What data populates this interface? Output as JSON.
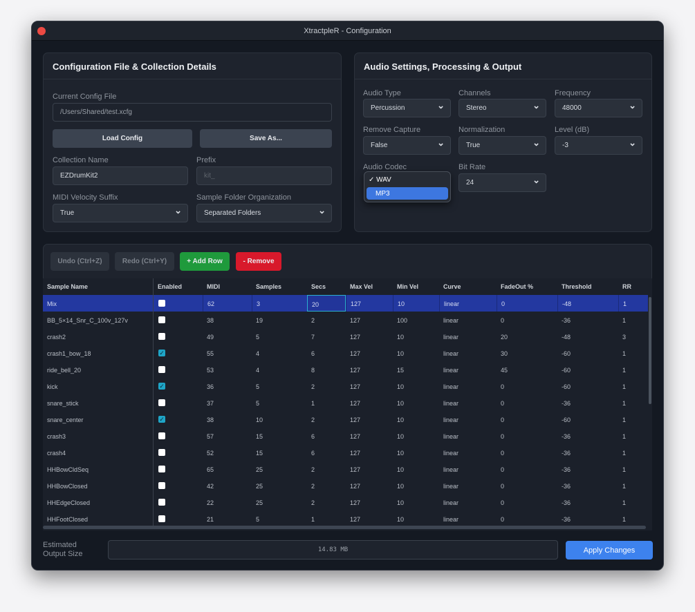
{
  "window": {
    "title": "XtractpleR - Configuration"
  },
  "config": {
    "title": "Configuration File & Collection Details",
    "current_label": "Current Config File",
    "current_value": "/Users/Shared/test.xcfg",
    "load": "Load Config",
    "save": "Save As...",
    "collection_label": "Collection Name",
    "collection_value": "EZDrumKit2",
    "prefix_label": "Prefix",
    "prefix_placeholder": "kit_",
    "midi_label": "MIDI Velocity Suffix",
    "midi_value": "True",
    "folder_label": "Sample Folder Organization",
    "folder_value": "Separated Folders"
  },
  "audio": {
    "title": "Audio Settings, Processing & Output",
    "type_label": "Audio Type",
    "type_value": "Percussion",
    "channels_label": "Channels",
    "channels_value": "Stereo",
    "freq_label": "Frequency",
    "freq_value": "48000",
    "capture_label": "Remove Capture",
    "capture_value": "False",
    "norm_label": "Normalization",
    "norm_value": "True",
    "level_label": "Level (dB)",
    "level_value": "-3",
    "codec_label": "Audio Codec",
    "codec_options": [
      "✓ WAV",
      "MP3"
    ],
    "bitrate_label": "Bit Rate",
    "bitrate_value": "24"
  },
  "toolbar": {
    "undo": "Undo (Ctrl+Z)",
    "redo": "Redo (Ctrl+Y)",
    "add": "+ Add Row",
    "remove": "- Remove"
  },
  "colors": {
    "add": "#1f9a3c",
    "remove": "#d8192b",
    "apply": "#3d82ee",
    "selected_row": "#2338a0"
  },
  "table": {
    "columns": [
      "Sample Name",
      "Enabled",
      "MIDI",
      "Samples",
      "Secs",
      "Max Vel",
      "Min Vel",
      "Curve",
      "FadeOut %",
      "Threshold",
      "RR"
    ],
    "rows": [
      [
        "Mix",
        false,
        "62",
        "3",
        "20",
        "127",
        "10",
        "linear",
        "0",
        "-48",
        "1"
      ],
      [
        "BB_5×14_Snr_C_100v_127v",
        false,
        "38",
        "19",
        "2",
        "127",
        "100",
        "linear",
        "0",
        "-36",
        "1"
      ],
      [
        "crash2",
        false,
        "49",
        "5",
        "7",
        "127",
        "10",
        "linear",
        "20",
        "-48",
        "3"
      ],
      [
        "crash1_bow_18",
        true,
        "55",
        "4",
        "6",
        "127",
        "10",
        "linear",
        "30",
        "-60",
        "1"
      ],
      [
        "ride_bell_20",
        false,
        "53",
        "4",
        "8",
        "127",
        "15",
        "linear",
        "45",
        "-60",
        "1"
      ],
      [
        "kick",
        true,
        "36",
        "5",
        "2",
        "127",
        "10",
        "linear",
        "0",
        "-60",
        "1"
      ],
      [
        "snare_stick",
        false,
        "37",
        "5",
        "1",
        "127",
        "10",
        "linear",
        "0",
        "-36",
        "1"
      ],
      [
        "snare_center",
        true,
        "38",
        "10",
        "2",
        "127",
        "10",
        "linear",
        "0",
        "-60",
        "1"
      ],
      [
        "crash3",
        false,
        "57",
        "15",
        "6",
        "127",
        "10",
        "linear",
        "0",
        "-36",
        "1"
      ],
      [
        "crash4",
        false,
        "52",
        "15",
        "6",
        "127",
        "10",
        "linear",
        "0",
        "-36",
        "1"
      ],
      [
        "HHBowCldSeq",
        false,
        "65",
        "25",
        "2",
        "127",
        "10",
        "linear",
        "0",
        "-36",
        "1"
      ],
      [
        "HHBowClosed",
        false,
        "42",
        "25",
        "2",
        "127",
        "10",
        "linear",
        "0",
        "-36",
        "1"
      ],
      [
        "HHEdgeClosed",
        false,
        "22",
        "25",
        "2",
        "127",
        "10",
        "linear",
        "0",
        "-36",
        "1"
      ],
      [
        "HHFootClosed",
        false,
        "21",
        "5",
        "1",
        "127",
        "10",
        "linear",
        "0",
        "-36",
        "1"
      ]
    ]
  },
  "footer": {
    "size_label": "Estimated Output Size",
    "size_value": "14.83 MB",
    "apply": "Apply Changes"
  }
}
